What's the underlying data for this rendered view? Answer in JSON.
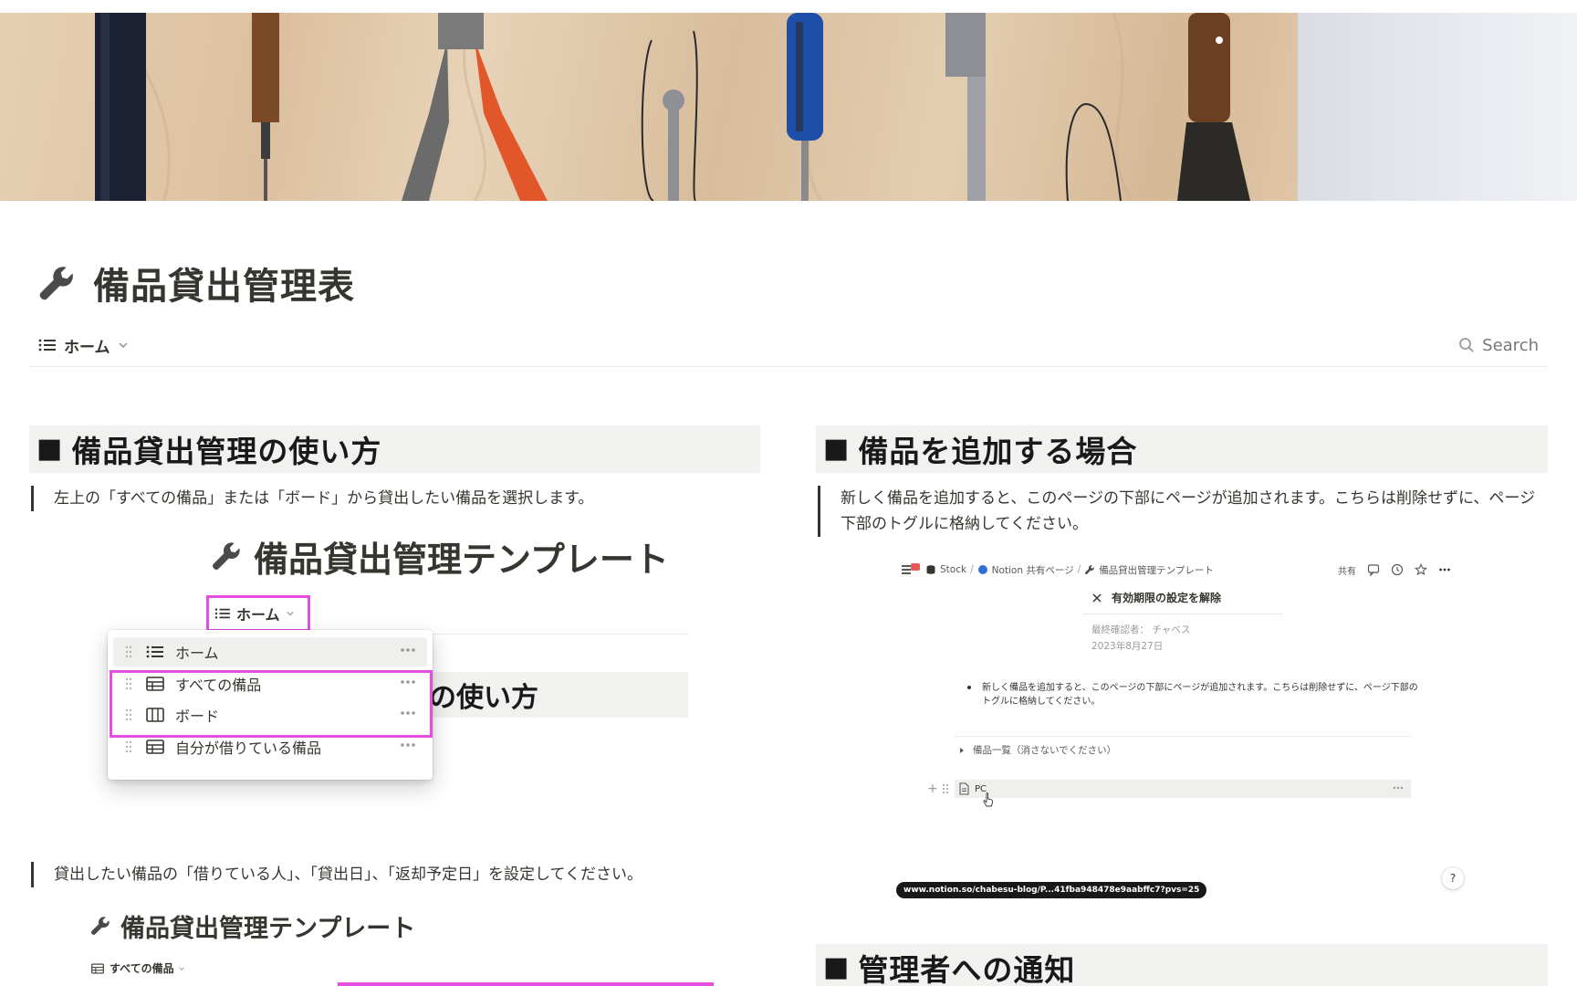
{
  "page": {
    "icon": "wrench-icon",
    "title": "備品貸出管理表"
  },
  "view_bar": {
    "current_view": "ホーム",
    "current_view_icon": "list-icon",
    "search_label": "Search"
  },
  "left_column": {
    "heading1": "備品貸出管理の使い方",
    "quote1": "左上の「すべての備品」または「ボード」から貸出したい備品を選択します。",
    "screenshot1": {
      "title": "備品貸出管理テンプレート",
      "view_pill": "ホーム",
      "bg_heading_fragment": "の使い方",
      "dropdown_items": [
        {
          "label": "ホーム",
          "icon": "list-icon"
        },
        {
          "label": "すべての備品",
          "icon": "table-icon"
        },
        {
          "label": "ボード",
          "icon": "board-icon"
        },
        {
          "label": "自分が借りている備品",
          "icon": "table-icon"
        }
      ]
    },
    "quote2": "貸出したい備品の「借りている人」、「貸出日」、「返却予定日」を設定してください。",
    "screenshot2": {
      "title": "備品貸出管理テンプレート",
      "view": "すべての備品"
    }
  },
  "right_column": {
    "heading1": "備品を追加する場合",
    "quote1": "新しく備品を追加すると、このページの下部にページが追加されます。こちらは削除せずに、ページ下部のトグルに格納してください。",
    "screenshot": {
      "breadcrumbs": [
        "Stock",
        "Notion 共有ページ",
        "備品貸出管理テンプレート"
      ],
      "share": "共有",
      "unset_label": "有効期限の設定を解除",
      "meta_verifier": "最終確認者： チャベス",
      "meta_date": "2023年8月27日",
      "bullet": "新しく備品を追加すると、このページの下部にページが追加されます。こちらは削除せずに、ページ下部のトグルに格納してください。",
      "toggle": "備品一覧（消さないでください）",
      "pc_row": "PC",
      "url": "www.notion.so/chabesu-blog/P...41fba948478e9aabffc7?pvs=25",
      "help": "?"
    },
    "heading2": "管理者への通知"
  },
  "colors": {
    "highlight": "#e44fe0",
    "heading_bg": "#f1f1ef",
    "text": "#37352f"
  }
}
